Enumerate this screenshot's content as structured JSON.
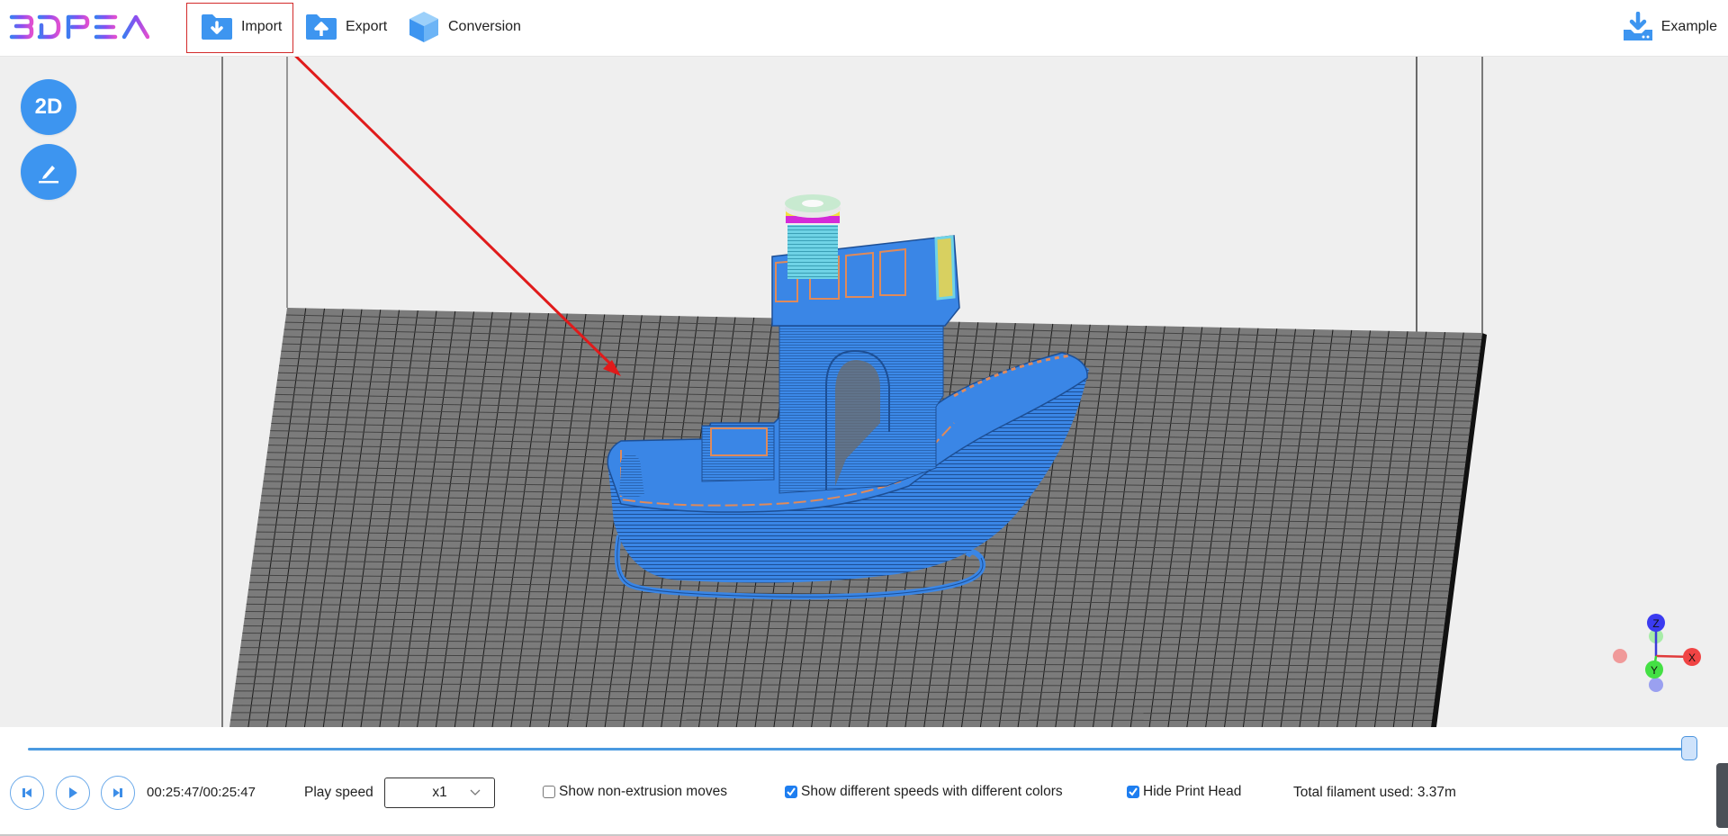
{
  "header": {
    "logo_text": "3DPEA",
    "logo_gradient": [
      "#3d7cf0",
      "#8b4ef0",
      "#e04fd0"
    ],
    "buttons": [
      {
        "label": "Import",
        "icon": "folder-download-icon"
      },
      {
        "label": "Export",
        "icon": "folder-upload-icon"
      },
      {
        "label": "Conversion",
        "icon": "cube-icon"
      }
    ],
    "example": {
      "label": "Example",
      "icon": "download-tray-icon"
    },
    "highlight_color": "#d32a2a"
  },
  "viewport": {
    "view_2d_label": "2D",
    "edit_icon": "pencil-icon",
    "axis_labels": {
      "x": "X",
      "y": "Y",
      "z": "Z"
    },
    "accent": "#3d95f0",
    "model_color": "#3a86e6",
    "bed_color": "#7b7b7b"
  },
  "footer": {
    "progress": 1.0,
    "time": "00:25:47/00:25:47",
    "play_speed_label": "Play speed",
    "play_speed_value": "x1",
    "options": [
      {
        "label": "Show non-extrusion moves",
        "checked": false
      },
      {
        "label": "Show different speeds with different colors",
        "checked": true
      },
      {
        "label": "Hide Print Head",
        "checked": true
      }
    ],
    "filament_label": "Total filament used:",
    "filament_value": "3.37m"
  }
}
